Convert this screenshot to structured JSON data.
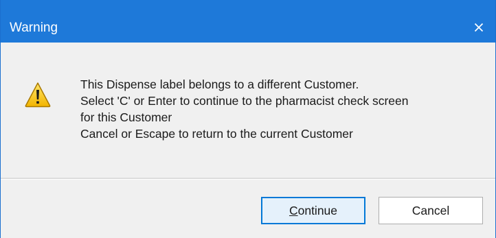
{
  "window": {
    "title": "Warning",
    "close_label": "×"
  },
  "message": {
    "lines": [
      "This Dispense label belongs to a different Customer.",
      "Select 'C' or Enter to continue to the pharmacist check screen",
      "for this Customer",
      "Cancel or Escape to return to the current Customer"
    ]
  },
  "icons": {
    "warning": "warning-icon",
    "close": "close-icon"
  },
  "buttons": {
    "continue_accel": "C",
    "continue_rest": "ontinue",
    "cancel": "Cancel"
  },
  "colors": {
    "titlebar": "#1e79d9",
    "default_button_border": "#0078d7",
    "default_button_fill": "#e5f1fb"
  }
}
